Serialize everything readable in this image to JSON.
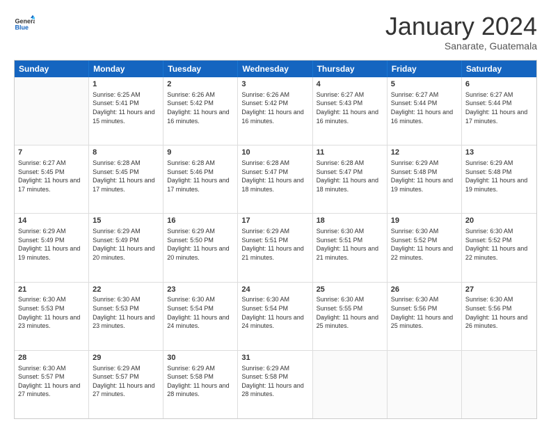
{
  "header": {
    "logo": {
      "general": "General",
      "blue": "Blue"
    },
    "title": "January 2024",
    "location": "Sanarate, Guatemala"
  },
  "days": [
    "Sunday",
    "Monday",
    "Tuesday",
    "Wednesday",
    "Thursday",
    "Friday",
    "Saturday"
  ],
  "weeks": [
    [
      {
        "day": "",
        "empty": true
      },
      {
        "day": "1",
        "sunrise": "Sunrise: 6:25 AM",
        "sunset": "Sunset: 5:41 PM",
        "daylight": "Daylight: 11 hours and 15 minutes."
      },
      {
        "day": "2",
        "sunrise": "Sunrise: 6:26 AM",
        "sunset": "Sunset: 5:42 PM",
        "daylight": "Daylight: 11 hours and 16 minutes."
      },
      {
        "day": "3",
        "sunrise": "Sunrise: 6:26 AM",
        "sunset": "Sunset: 5:42 PM",
        "daylight": "Daylight: 11 hours and 16 minutes."
      },
      {
        "day": "4",
        "sunrise": "Sunrise: 6:27 AM",
        "sunset": "Sunset: 5:43 PM",
        "daylight": "Daylight: 11 hours and 16 minutes."
      },
      {
        "day": "5",
        "sunrise": "Sunrise: 6:27 AM",
        "sunset": "Sunset: 5:44 PM",
        "daylight": "Daylight: 11 hours and 16 minutes."
      },
      {
        "day": "6",
        "sunrise": "Sunrise: 6:27 AM",
        "sunset": "Sunset: 5:44 PM",
        "daylight": "Daylight: 11 hours and 17 minutes."
      }
    ],
    [
      {
        "day": "7",
        "sunrise": "Sunrise: 6:27 AM",
        "sunset": "Sunset: 5:45 PM",
        "daylight": "Daylight: 11 hours and 17 minutes."
      },
      {
        "day": "8",
        "sunrise": "Sunrise: 6:28 AM",
        "sunset": "Sunset: 5:45 PM",
        "daylight": "Daylight: 11 hours and 17 minutes."
      },
      {
        "day": "9",
        "sunrise": "Sunrise: 6:28 AM",
        "sunset": "Sunset: 5:46 PM",
        "daylight": "Daylight: 11 hours and 17 minutes."
      },
      {
        "day": "10",
        "sunrise": "Sunrise: 6:28 AM",
        "sunset": "Sunset: 5:47 PM",
        "daylight": "Daylight: 11 hours and 18 minutes."
      },
      {
        "day": "11",
        "sunrise": "Sunrise: 6:28 AM",
        "sunset": "Sunset: 5:47 PM",
        "daylight": "Daylight: 11 hours and 18 minutes."
      },
      {
        "day": "12",
        "sunrise": "Sunrise: 6:29 AM",
        "sunset": "Sunset: 5:48 PM",
        "daylight": "Daylight: 11 hours and 19 minutes."
      },
      {
        "day": "13",
        "sunrise": "Sunrise: 6:29 AM",
        "sunset": "Sunset: 5:48 PM",
        "daylight": "Daylight: 11 hours and 19 minutes."
      }
    ],
    [
      {
        "day": "14",
        "sunrise": "Sunrise: 6:29 AM",
        "sunset": "Sunset: 5:49 PM",
        "daylight": "Daylight: 11 hours and 19 minutes."
      },
      {
        "day": "15",
        "sunrise": "Sunrise: 6:29 AM",
        "sunset": "Sunset: 5:49 PM",
        "daylight": "Daylight: 11 hours and 20 minutes."
      },
      {
        "day": "16",
        "sunrise": "Sunrise: 6:29 AM",
        "sunset": "Sunset: 5:50 PM",
        "daylight": "Daylight: 11 hours and 20 minutes."
      },
      {
        "day": "17",
        "sunrise": "Sunrise: 6:29 AM",
        "sunset": "Sunset: 5:51 PM",
        "daylight": "Daylight: 11 hours and 21 minutes."
      },
      {
        "day": "18",
        "sunrise": "Sunrise: 6:30 AM",
        "sunset": "Sunset: 5:51 PM",
        "daylight": "Daylight: 11 hours and 21 minutes."
      },
      {
        "day": "19",
        "sunrise": "Sunrise: 6:30 AM",
        "sunset": "Sunset: 5:52 PM",
        "daylight": "Daylight: 11 hours and 22 minutes."
      },
      {
        "day": "20",
        "sunrise": "Sunrise: 6:30 AM",
        "sunset": "Sunset: 5:52 PM",
        "daylight": "Daylight: 11 hours and 22 minutes."
      }
    ],
    [
      {
        "day": "21",
        "sunrise": "Sunrise: 6:30 AM",
        "sunset": "Sunset: 5:53 PM",
        "daylight": "Daylight: 11 hours and 23 minutes."
      },
      {
        "day": "22",
        "sunrise": "Sunrise: 6:30 AM",
        "sunset": "Sunset: 5:53 PM",
        "daylight": "Daylight: 11 hours and 23 minutes."
      },
      {
        "day": "23",
        "sunrise": "Sunrise: 6:30 AM",
        "sunset": "Sunset: 5:54 PM",
        "daylight": "Daylight: 11 hours and 24 minutes."
      },
      {
        "day": "24",
        "sunrise": "Sunrise: 6:30 AM",
        "sunset": "Sunset: 5:54 PM",
        "daylight": "Daylight: 11 hours and 24 minutes."
      },
      {
        "day": "25",
        "sunrise": "Sunrise: 6:30 AM",
        "sunset": "Sunset: 5:55 PM",
        "daylight": "Daylight: 11 hours and 25 minutes."
      },
      {
        "day": "26",
        "sunrise": "Sunrise: 6:30 AM",
        "sunset": "Sunset: 5:56 PM",
        "daylight": "Daylight: 11 hours and 25 minutes."
      },
      {
        "day": "27",
        "sunrise": "Sunrise: 6:30 AM",
        "sunset": "Sunset: 5:56 PM",
        "daylight": "Daylight: 11 hours and 26 minutes."
      }
    ],
    [
      {
        "day": "28",
        "sunrise": "Sunrise: 6:30 AM",
        "sunset": "Sunset: 5:57 PM",
        "daylight": "Daylight: 11 hours and 27 minutes."
      },
      {
        "day": "29",
        "sunrise": "Sunrise: 6:29 AM",
        "sunset": "Sunset: 5:57 PM",
        "daylight": "Daylight: 11 hours and 27 minutes."
      },
      {
        "day": "30",
        "sunrise": "Sunrise: 6:29 AM",
        "sunset": "Sunset: 5:58 PM",
        "daylight": "Daylight: 11 hours and 28 minutes."
      },
      {
        "day": "31",
        "sunrise": "Sunrise: 6:29 AM",
        "sunset": "Sunset: 5:58 PM",
        "daylight": "Daylight: 11 hours and 28 minutes."
      },
      {
        "day": "",
        "empty": true
      },
      {
        "day": "",
        "empty": true
      },
      {
        "day": "",
        "empty": true
      }
    ]
  ]
}
